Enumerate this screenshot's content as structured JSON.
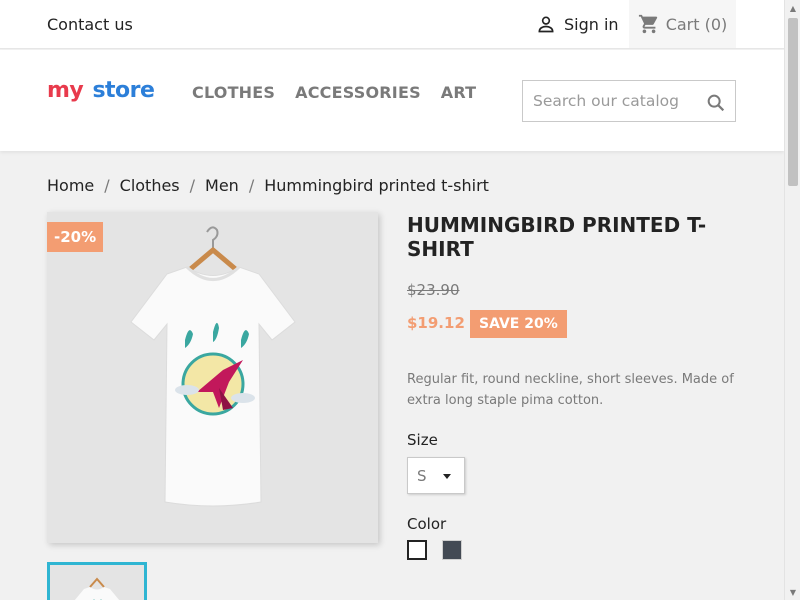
{
  "topbar": {
    "contact": "Contact us",
    "signin": "Sign in",
    "cart": "Cart (0)"
  },
  "header": {
    "logo": {
      "word1": "my",
      "word2": "store"
    },
    "nav": [
      "CLOTHES",
      "ACCESSORIES",
      "ART"
    ],
    "search_placeholder": "Search our catalog"
  },
  "breadcrumb": [
    "Home",
    "Clothes",
    "Men",
    "Hummingbird printed t-shirt"
  ],
  "breadcrumb_sep": "/",
  "product": {
    "discount_badge": "-20%",
    "title": "HUMMINGBIRD PRINTED T-SHIRT",
    "old_price": "$23.90",
    "price": "$19.12",
    "save_badge": "SAVE 20%",
    "description": "Regular fit, round neckline, short sleeves. Made of extra long staple pima cotton.",
    "size_label": "Size",
    "size_value": "S",
    "color_label": "Color",
    "colors": [
      "#ffffff",
      "#434a54"
    ]
  },
  "theme": {
    "accent": "#2fb5d2",
    "sale": "#f39d72"
  }
}
